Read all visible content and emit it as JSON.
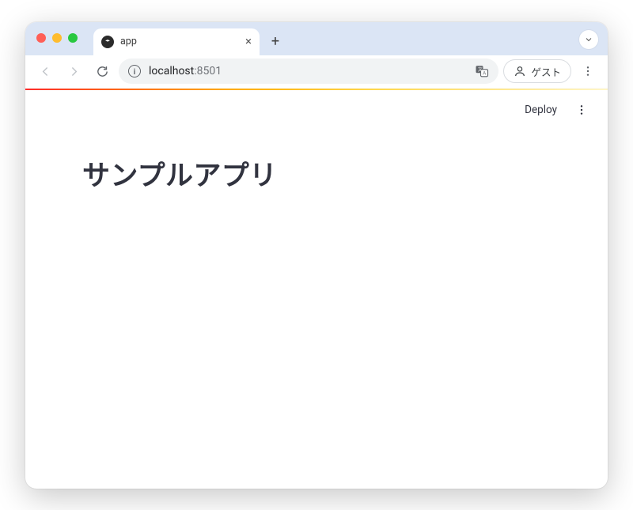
{
  "browser": {
    "tab": {
      "title": "app"
    },
    "url": {
      "host": "localhost",
      "port": ":8501"
    },
    "profile_label": "ゲスト"
  },
  "app": {
    "header": {
      "deploy_label": "Deploy"
    },
    "title": "サンプルアプリ"
  }
}
